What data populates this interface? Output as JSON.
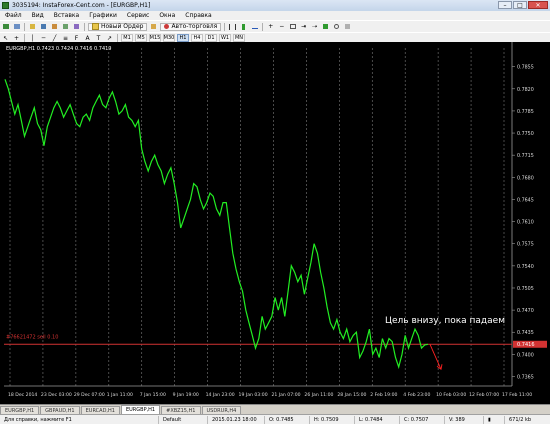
{
  "window": {
    "title": "3035194: InstaForex-Cent.com - [EURGBP,H1]"
  },
  "window_buttons": {
    "minimize": "–",
    "maximize": "□",
    "close": "✕"
  },
  "menu": [
    "Файл",
    "Вид",
    "Вставка",
    "Графики",
    "Сервис",
    "Окна",
    "Справка"
  ],
  "toolbar": {
    "new_order": "Новый Ордер",
    "auto_trading": "Авто-торговля"
  },
  "timeframes": [
    "M1",
    "M5",
    "M15",
    "M30",
    "H1",
    "H4",
    "D1",
    "W1",
    "MN"
  ],
  "active_timeframe": "H1",
  "chart": {
    "header": "EURGBP,H1  0.7423 0.7424 0.7416 0.7419",
    "line_label": "#76621472 sell 0.10",
    "price_labels": [
      "0.7855",
      "0.7820",
      "0.7785",
      "0.7750",
      "0.7715",
      "0.7680",
      "0.7645",
      "0.7610",
      "0.7575",
      "0.7540",
      "0.7505",
      "0.7470",
      "0.7435",
      "0.7400",
      "0.7365"
    ],
    "current_price": "0.7416",
    "time_labels": [
      "18 Dec 2014",
      "23 Dec 03:00",
      "29 Dec 07:00",
      "1 Jan 11:00",
      "7 Jan 15:00",
      "9 Jan 19:00",
      "14 Jan 23:00",
      "19 Jan 03:00",
      "21 Jan 07:00",
      "26 Jan 11:00",
      "28 Jan 15:00",
      "2 Feb 19:00",
      "4 Feb 23:00",
      "10 Feb 03:00",
      "12 Feb 07:00",
      "17 Feb 11:00"
    ],
    "annotation": "Цель внизу, пока падаем",
    "colors": {
      "background": "#000000",
      "price": "#22ee22",
      "trade_line": "#d23232",
      "grid": "#7a7a7a",
      "arrow": "#ff2020"
    }
  },
  "chart_data": {
    "type": "line",
    "title": "EURGBP,H1",
    "ylim": [
      0.735,
      0.7875
    ],
    "y_ticks": [
      0.7855,
      0.782,
      0.7785,
      0.775,
      0.7715,
      0.768,
      0.7645,
      0.761,
      0.7575,
      0.754,
      0.7505,
      0.747,
      0.7435,
      0.74,
      0.7365
    ],
    "trade_price": 0.7416,
    "close": 0.7419,
    "series": [
      {
        "values": [
          0.7835,
          0.782,
          0.78,
          0.778,
          0.7795,
          0.777,
          0.7745,
          0.776,
          0.7775,
          0.779,
          0.7765,
          0.7755,
          0.773,
          0.776,
          0.7775,
          0.779,
          0.78,
          0.779,
          0.7775,
          0.7785,
          0.7795,
          0.778,
          0.7765,
          0.776,
          0.7775,
          0.778,
          0.777,
          0.779,
          0.78,
          0.781,
          0.7795,
          0.779,
          0.7805,
          0.7815,
          0.78,
          0.778,
          0.7785,
          0.7795,
          0.7775,
          0.777,
          0.776,
          0.777,
          0.7725,
          0.7705,
          0.769,
          0.7705,
          0.7715,
          0.77,
          0.769,
          0.767,
          0.7685,
          0.7695,
          0.767,
          0.764,
          0.76,
          0.7615,
          0.763,
          0.7645,
          0.767,
          0.7665,
          0.7645,
          0.763,
          0.764,
          0.7655,
          0.765,
          0.763,
          0.762,
          0.764,
          0.764,
          0.76,
          0.756,
          0.7535,
          0.7515,
          0.75,
          0.747,
          0.745,
          0.743,
          0.741,
          0.7425,
          0.746,
          0.744,
          0.745,
          0.746,
          0.749,
          0.747,
          0.749,
          0.746,
          0.75,
          0.754,
          0.753,
          0.7515,
          0.7525,
          0.7495,
          0.752,
          0.7545,
          0.7575,
          0.756,
          0.753,
          0.7505,
          0.7475,
          0.745,
          0.744,
          0.7455,
          0.7435,
          0.7425,
          0.744,
          0.742,
          0.743,
          0.7435,
          0.7395,
          0.7405,
          0.742,
          0.744,
          0.74,
          0.741,
          0.7395,
          0.7425,
          0.741,
          0.7425,
          0.742,
          0.7395,
          0.738,
          0.74,
          0.743,
          0.741,
          0.7425,
          0.744,
          0.743,
          0.741,
          0.7415,
          0.7416
        ]
      }
    ]
  }
}
